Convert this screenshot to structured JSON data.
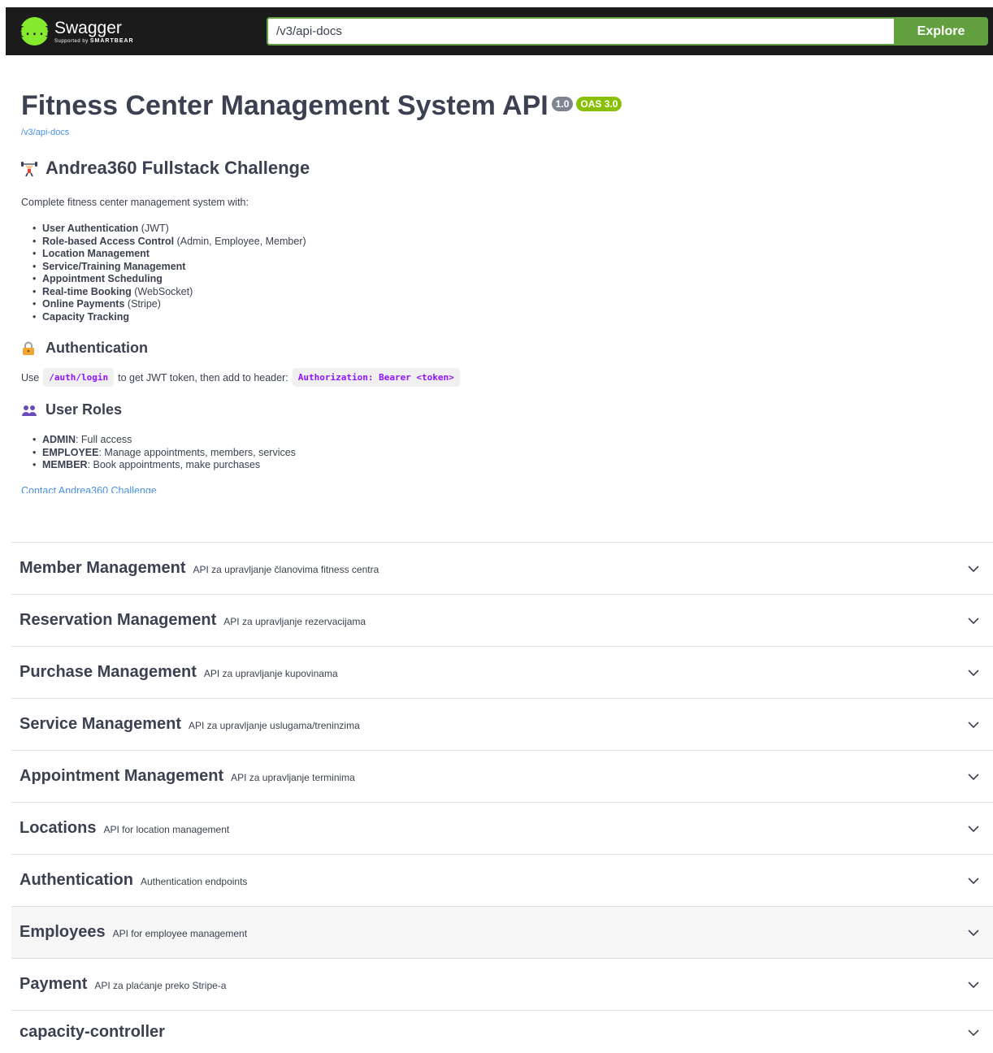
{
  "topbar": {
    "logo_name": "Swagger",
    "logo_sub_prefix": "Supported by",
    "logo_sub_brand": "SMARTBEAR",
    "logo_glyph": "{...}",
    "url_value": "/v3/api-docs",
    "explore_label": "Explore"
  },
  "info": {
    "title": "Fitness Center Management System API",
    "version_badge": "1.0",
    "oas_badge": "OAS 3.0",
    "spec_link": "/v3/api-docs",
    "heading": "Andrea360 Fullstack Challenge",
    "heading_icon": "weightlifter-icon",
    "description": "Complete fitness center management system with:",
    "features": [
      {
        "bold": "User Authentication",
        "rest": " (JWT)"
      },
      {
        "bold": "Role-based Access Control",
        "rest": " (Admin, Employee, Member)"
      },
      {
        "bold": "Location Management",
        "rest": ""
      },
      {
        "bold": "Service/Training Management",
        "rest": ""
      },
      {
        "bold": "Appointment Scheduling",
        "rest": ""
      },
      {
        "bold": "Real-time Booking",
        "rest": " (WebSocket)"
      },
      {
        "bold": "Online Payments",
        "rest": " (Stripe)"
      },
      {
        "bold": "Capacity Tracking",
        "rest": ""
      }
    ],
    "auth_heading": "Authentication",
    "auth_icon": "lock-icon",
    "auth_use": "Use",
    "auth_endpoint": "/auth/login",
    "auth_middle": "to get JWT token, then add to header:",
    "auth_header_code": "Authorization: Bearer <token>",
    "roles_heading": "User Roles",
    "roles_icon": "users-icon",
    "roles": [
      {
        "bold": "ADMIN",
        "rest": ": Full access"
      },
      {
        "bold": "EMPLOYEE",
        "rest": ": Manage appointments, members, services"
      },
      {
        "bold": "MEMBER",
        "rest": ": Book appointments, make purchases"
      }
    ],
    "contact_link": "Contact Andrea360 Challenge"
  },
  "tags": [
    {
      "name": "Member Management",
      "desc": "API za upravljanje članovima fitness centra"
    },
    {
      "name": "Reservation Management",
      "desc": "API za upravljanje rezervacijama"
    },
    {
      "name": "Purchase Management",
      "desc": "API za upravljanje kupovinama"
    },
    {
      "name": "Service Management",
      "desc": "API za upravljanje uslugama/treninzima"
    },
    {
      "name": "Appointment Management",
      "desc": "API za upravljanje terminima"
    },
    {
      "name": "Locations",
      "desc": "API for location management"
    },
    {
      "name": "Authentication",
      "desc": "Authentication endpoints"
    },
    {
      "name": "Employees",
      "desc": "API for employee management"
    },
    {
      "name": "Payment",
      "desc": "API za plaćanje preko Stripe-a"
    },
    {
      "name": "capacity-controller",
      "desc": ""
    }
  ],
  "colors": {
    "topbar_bg": "#1b1b1b",
    "accent_green": "#62a03f",
    "logo_green": "#85ea2d",
    "link_blue": "#4990e2",
    "code_purple": "#9012fe",
    "text": "#3b4151"
  }
}
